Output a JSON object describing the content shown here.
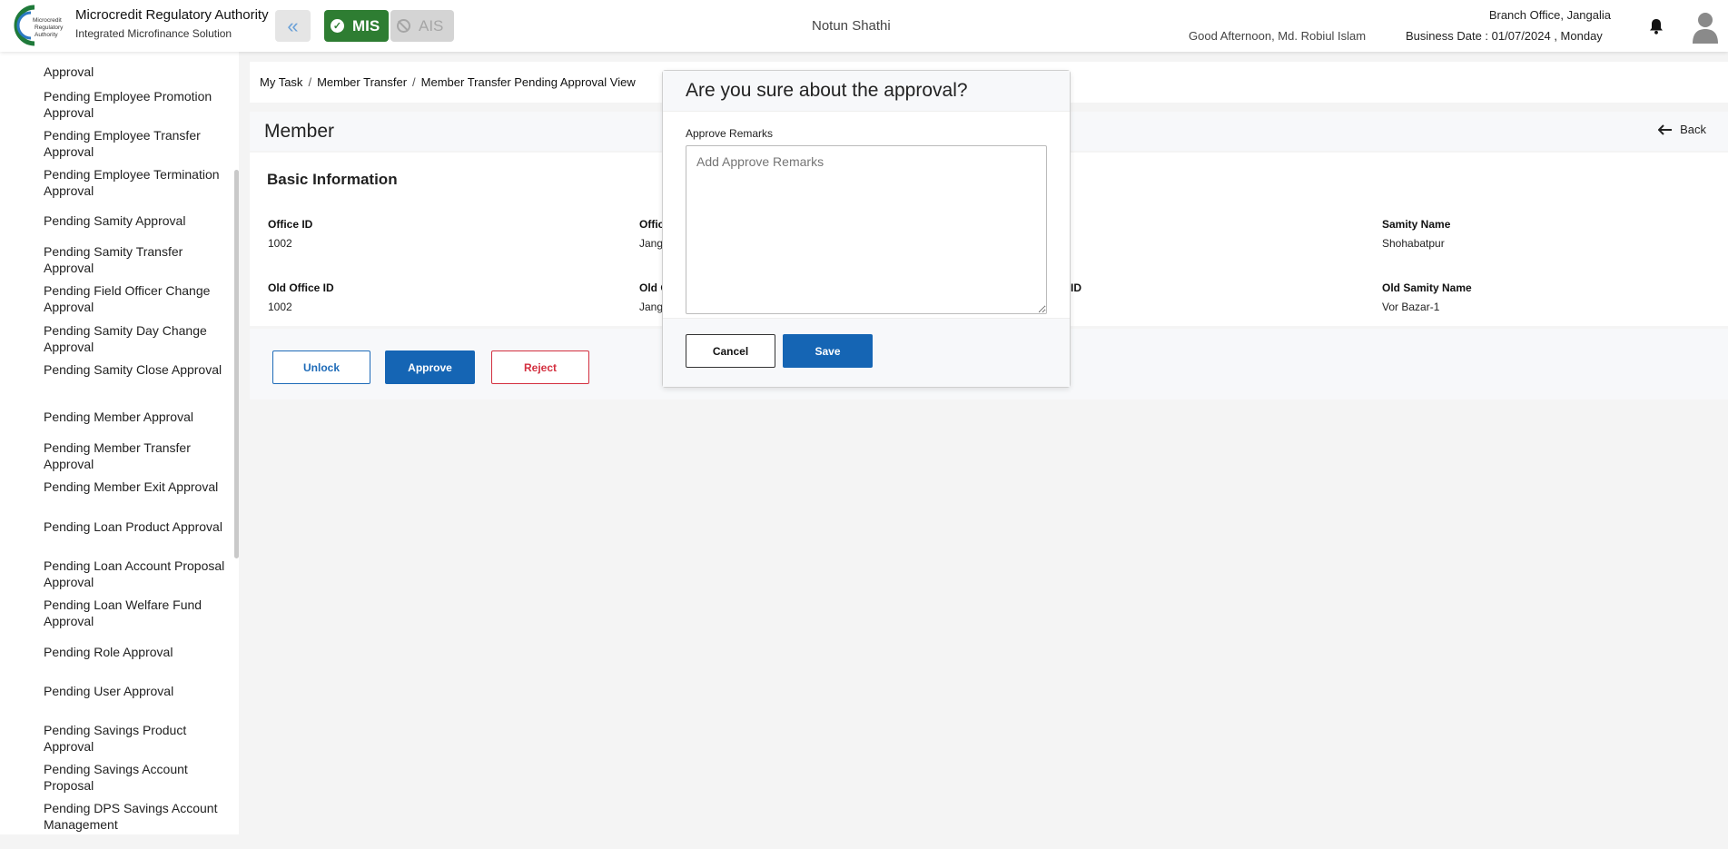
{
  "header": {
    "logo_text": "Microcredit Regulatory Authority",
    "org_name": "Microcredit Regulatory Authority",
    "org_subtitle": "Integrated Microfinance Solution",
    "mis_label": "MIS",
    "ais_label": "AIS",
    "app_title": "Notun Shathi",
    "greeting": "Good Afternoon, Md. Robiul Islam",
    "branch": "Branch Office, Jangalia",
    "business_date": "Business Date : 01/07/2024 , Monday",
    "colors": {
      "mis": "#2e7d32",
      "ais": "#d4d4d4",
      "primary": "#1565b4",
      "danger": "#d32f3f"
    }
  },
  "sidebar": {
    "items": [
      "Pending Employee Promotion Approval",
      "Pending Employee Transfer Approval",
      "Pending Employee Termination Approval",
      "Pending Samity Approval",
      "Pending Samity Transfer Approval",
      "Pending Field Officer Change Approval",
      "Pending Samity Day Change Approval",
      "Pending Samity Close Approval",
      "Pending Member Approval",
      "Pending Member Transfer Approval",
      "Pending Member Exit Approval",
      "Pending Loan Product Approval",
      "Pending Loan Account Proposal Approval",
      "Pending Loan Welfare Fund Approval",
      "Pending Role Approval",
      "Pending User Approval",
      "Pending Savings Product Approval",
      "Pending Savings Account Proposal",
      "Pending DPS Savings Account Management"
    ],
    "partial_top": "Approval"
  },
  "breadcrumb": {
    "items": [
      "My Task",
      "Member Transfer",
      "Member Transfer Pending Approval View"
    ],
    "separator": "/"
  },
  "main": {
    "title": "Member",
    "back_label": "Back",
    "section_title": "Basic Information",
    "fields": {
      "office_id_label": "Office ID",
      "office_id_value": "1002",
      "office_label_partial": "Offic",
      "office_value_partial": "Jang",
      "samity_name_label": "Samity Name",
      "samity_name_value": "Shohabatpur",
      "old_office_id_label": "Old Office ID",
      "old_office_id_value": "1002",
      "old_office_label_partial": "Old O",
      "old_office_value_partial": "Jang",
      "old_samity_id_partial": "ID",
      "old_samity_name_label": "Old Samity Name",
      "old_samity_name_value": "Vor Bazar-1"
    },
    "actions": {
      "unlock": "Unlock",
      "approve": "Approve",
      "reject": "Reject"
    }
  },
  "modal": {
    "title": "Are you sure about the approval?",
    "remarks_label": "Approve Remarks",
    "remarks_placeholder": "Add Approve Remarks",
    "remarks_value": "",
    "cancel_label": "Cancel",
    "save_label": "Save"
  }
}
